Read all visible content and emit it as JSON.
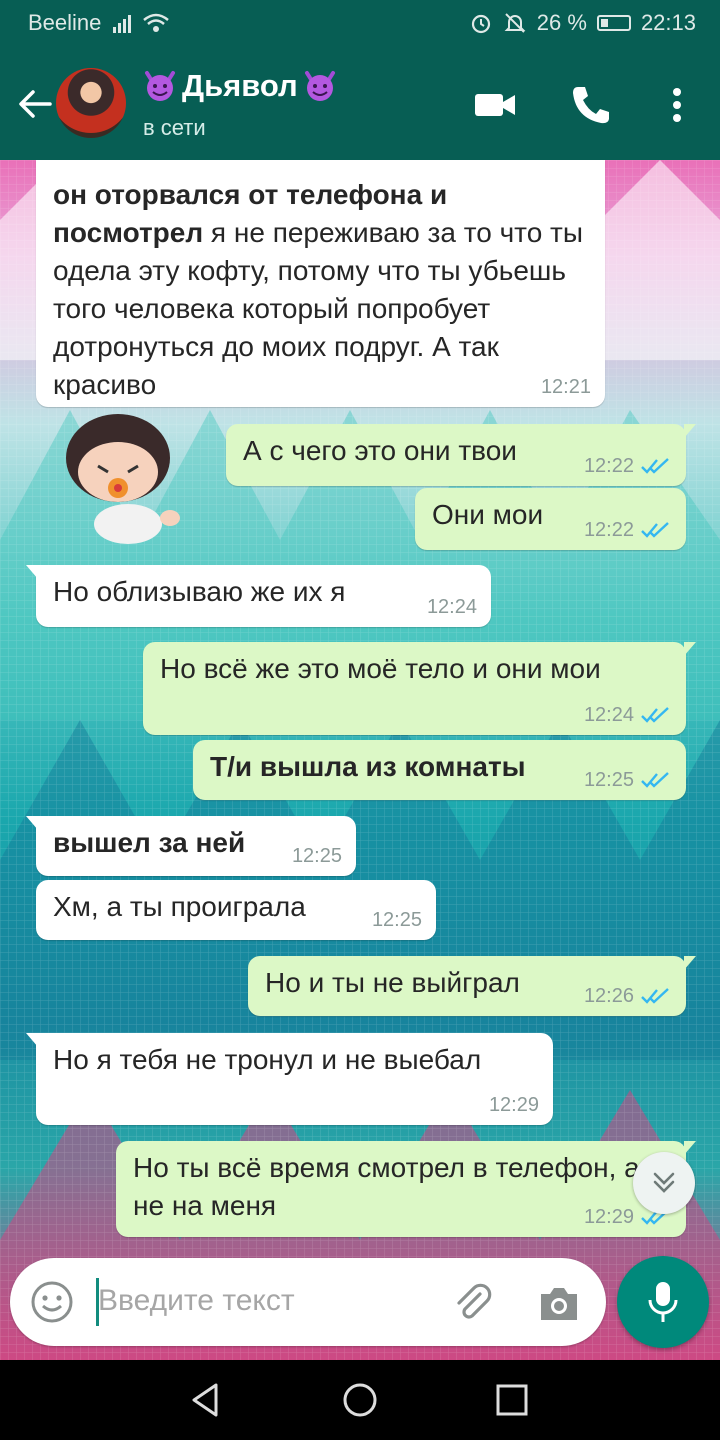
{
  "status_bar": {
    "carrier": "Beeline",
    "battery": "26 %",
    "time": "22:13"
  },
  "header": {
    "contact_name": "Дьявол",
    "status": "в сети"
  },
  "messages": [
    {
      "dir": "in",
      "bold": "он оторвался от телефона и посмотрел",
      "text": " я не переживаю за то что ты одела эту кофту, потому что ты убьешь того человека который попробует дотронуться до моих подруг. А так красиво",
      "time": "12:21"
    },
    {
      "dir": "out",
      "text": "А с чего это они твои",
      "time": "12:22",
      "read": true
    },
    {
      "dir": "out",
      "text": "Они мои",
      "time": "12:22",
      "read": true
    },
    {
      "dir": "in",
      "text": "Но облизываю же их я",
      "time": "12:24"
    },
    {
      "dir": "out",
      "text": "Но всё же это моё тело и они мои",
      "time": "12:24",
      "read": true
    },
    {
      "dir": "out",
      "bold": "Т/и вышла из комнаты",
      "text": "",
      "time": "12:25",
      "read": true
    },
    {
      "dir": "in",
      "bold": "вышел за ней",
      "text": "",
      "time": "12:25"
    },
    {
      "dir": "in",
      "text": "Хм, а ты проиграла",
      "time": "12:25"
    },
    {
      "dir": "out",
      "text": "Но и ты не выйграл",
      "time": "12:26",
      "read": true
    },
    {
      "dir": "in",
      "text": "Но я тебя не тронул и не выебал",
      "time": "12:29"
    },
    {
      "dir": "out",
      "text": "Но ты всё время смотрел в телефон, а не на меня",
      "time": "12:29",
      "read": true
    }
  ],
  "input": {
    "placeholder": "Введите текст"
  },
  "icons": {
    "back": "arrow-left-icon",
    "video": "video-call-icon",
    "call": "phone-icon",
    "menu": "more-vert-icon",
    "emoji": "emoji-icon",
    "attach": "paperclip-icon",
    "camera": "camera-icon",
    "mic": "mic-icon",
    "scroll": "chevron-double-down-icon"
  },
  "colors": {
    "header": "#075e54",
    "outgoing": "#dcf8c6",
    "incoming": "#ffffff",
    "accent": "#00897b",
    "read_ticks": "#34b7f1"
  }
}
